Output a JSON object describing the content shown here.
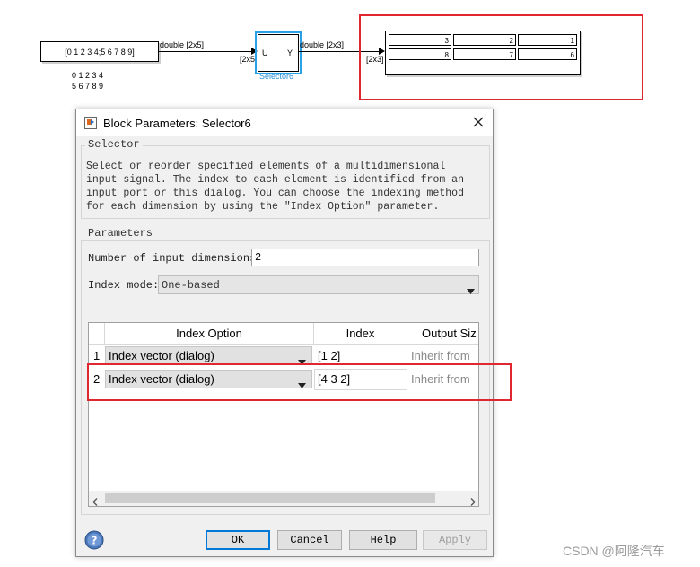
{
  "model": {
    "constant_value": "[0 1 2 3 4;5 6 7 8 9]",
    "constant_out_label": "double [2x5]",
    "matrix_row1": "0 1 2 3 4",
    "matrix_row2": "5 6 7 8 9",
    "selector_in_dim": "[2x5]",
    "selector_port_u": "U",
    "selector_port_y": "Y",
    "selector_name": "Selector6",
    "selector_out_label": "double [2x3]",
    "display_in_dim": "[2x3]",
    "display_values": [
      [
        "3",
        "2",
        "1"
      ],
      [
        "8",
        "7",
        "6"
      ]
    ],
    "highlight_color": "#e0262e",
    "selection_color": "#29a1e6"
  },
  "dialog": {
    "title": "Block Parameters: Selector6",
    "section_selector": "Selector",
    "description": "Select or reorder specified elements of a multidimensional input signal. The index to each element is identified from an input port or this dialog. You can choose the indexing method for each dimension by using the \"Index Option\" parameter.",
    "section_parameters": "Parameters",
    "num_dims_label": "Number of input dimensions:",
    "num_dims_value": "2",
    "index_mode_label": "Index mode:",
    "index_mode_value": "One-based",
    "table": {
      "headers": [
        "Index Option",
        "Index",
        "Output Siz"
      ],
      "rows": [
        {
          "num": "1",
          "option": "Index vector (dialog)",
          "index": "[1 2]",
          "output": "Inherit from"
        },
        {
          "num": "2",
          "option": "Index vector (dialog)",
          "index": "[4 3 2]",
          "output": "Inherit from"
        }
      ]
    },
    "buttons": {
      "ok": "OK",
      "cancel": "Cancel",
      "help": "Help",
      "apply": "Apply"
    }
  },
  "watermark": "CSDN @阿隆汽车"
}
